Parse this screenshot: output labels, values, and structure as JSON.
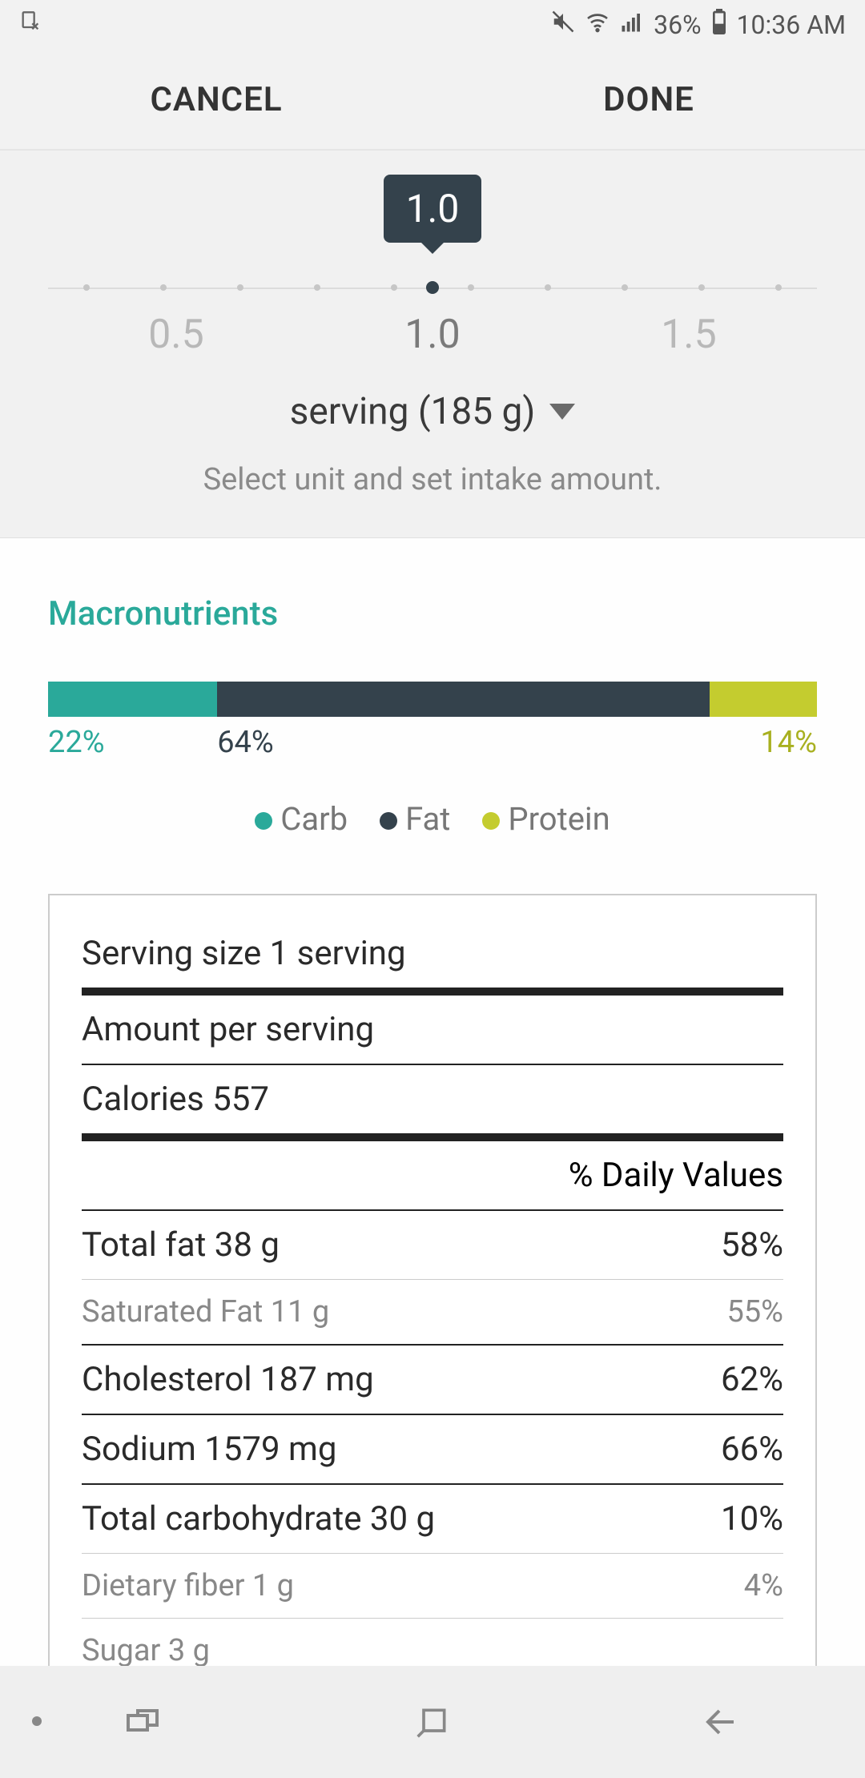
{
  "statusbar": {
    "battery_pct": "36%",
    "time": "10:36 AM"
  },
  "actions": {
    "cancel": "CANCEL",
    "done": "DONE"
  },
  "serving": {
    "bubble_value": "1.0",
    "tick_left": "0.5",
    "tick_mid": "1.0",
    "tick_right": "1.5",
    "unit_label": "serving (185 g)",
    "hint": "Select unit and set intake amount."
  },
  "macros": {
    "title": "Macronutrients",
    "carb": {
      "pct": 22,
      "label": "22%",
      "color": "#2aa99a",
      "name": "Carb"
    },
    "fat": {
      "pct": 64,
      "label": "64%",
      "color": "#34424c",
      "name": "Fat"
    },
    "protein": {
      "pct": 14,
      "label": "14%",
      "color": "#c4cc2f",
      "name": "Protein"
    }
  },
  "nutrition": {
    "serving_size": "Serving size 1 serving",
    "amount_per": "Amount per serving",
    "calories": "Calories 557",
    "dv_header": "% Daily Values",
    "rows": [
      {
        "label": "Total fat 38 g",
        "dv": "58%",
        "sub": false
      },
      {
        "label": "Saturated Fat 11 g",
        "dv": "55%",
        "sub": true
      },
      {
        "label": "Cholesterol 187 mg",
        "dv": "62%",
        "sub": false
      },
      {
        "label": "Sodium 1579 mg",
        "dv": "66%",
        "sub": false
      },
      {
        "label": "Total carbohydrate 30 g",
        "dv": "10%",
        "sub": false
      },
      {
        "label": "Dietary fiber 1 g",
        "dv": "4%",
        "sub": true
      },
      {
        "label": "Sugar 3 g",
        "dv": "",
        "sub": true
      }
    ]
  },
  "chart_data": {
    "type": "bar",
    "title": "Macronutrients",
    "categories": [
      "Carb",
      "Fat",
      "Protein"
    ],
    "values": [
      22,
      64,
      14
    ],
    "colors": [
      "#2aa99a",
      "#34424c",
      "#c4cc2f"
    ],
    "ylabel": "Percent",
    "xlabel": "",
    "ylim": [
      0,
      100
    ]
  }
}
